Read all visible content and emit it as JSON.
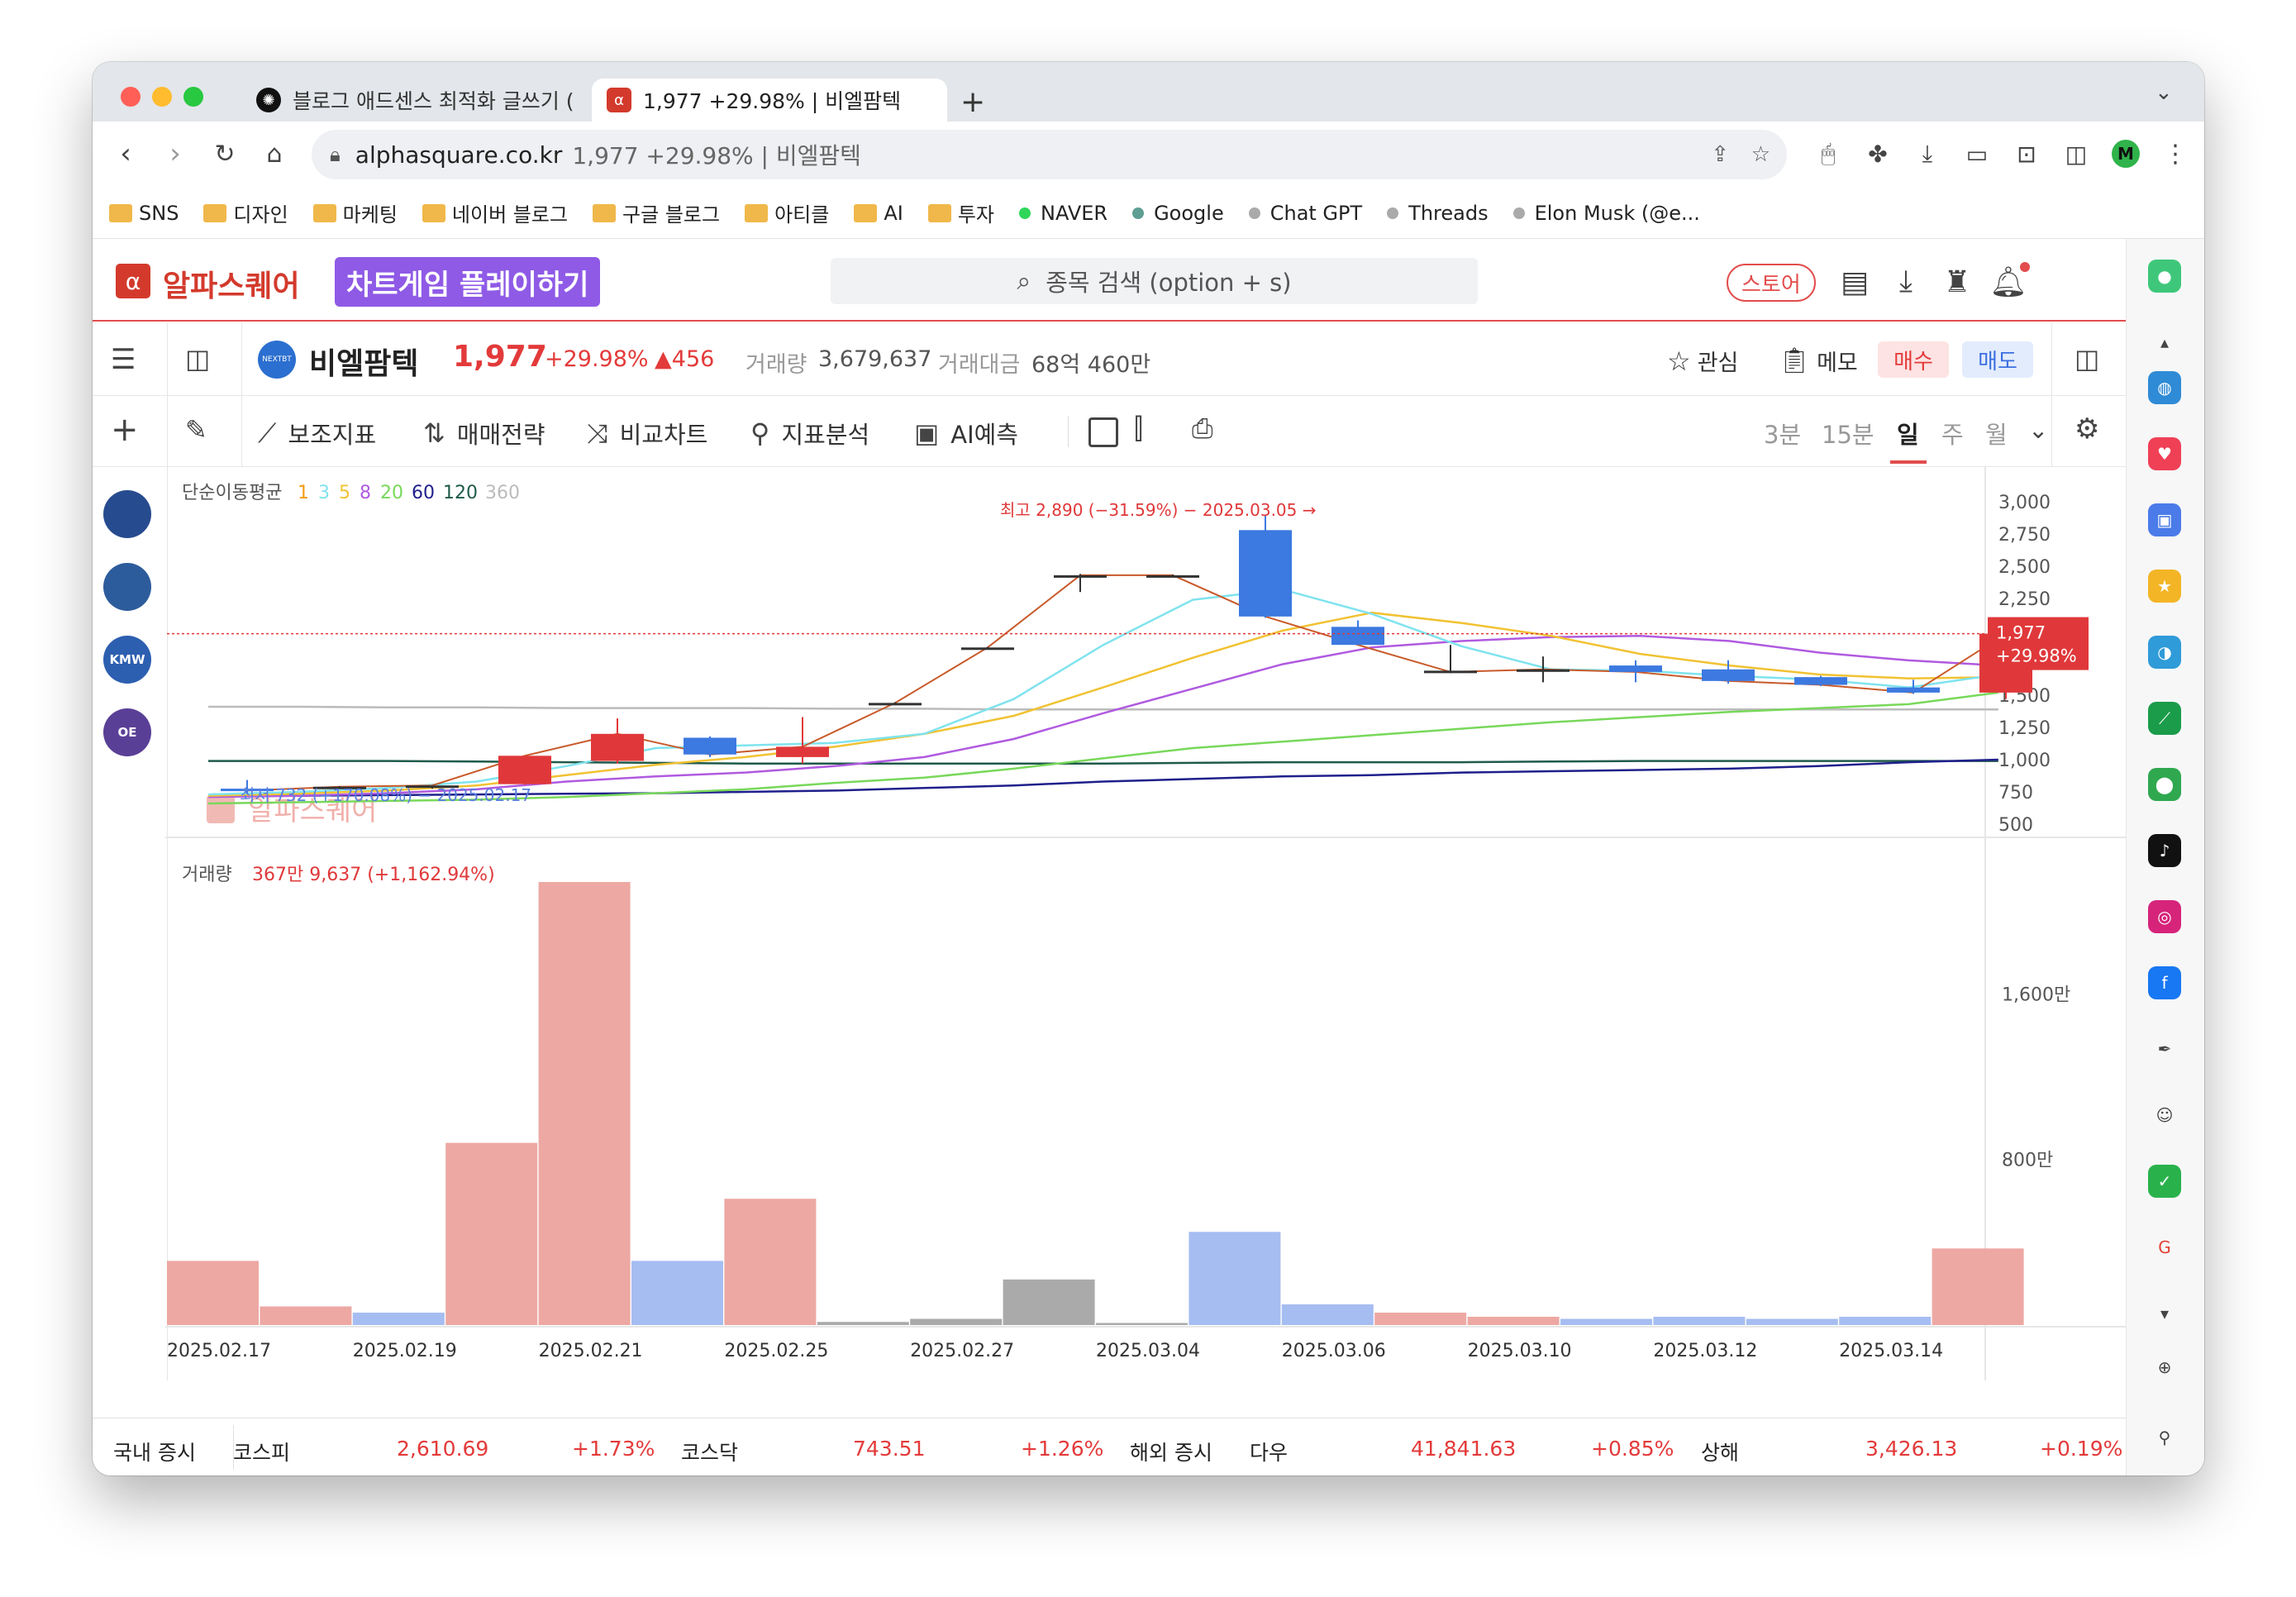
{
  "browser": {
    "tabs": [
      {
        "title": "블로그 애드센스 최적화 글쓰기 (",
        "icon": "chatgpt-icon"
      },
      {
        "title": "1,977 +29.98% | 비엘팜텍",
        "icon": "alphasquare-icon"
      }
    ],
    "new_tab": "+",
    "url_host": "alphasquare.co.kr",
    "url_title": "1,977 +29.98% | 비엘팜텍",
    "profile_letter": "M"
  },
  "bookmarks": [
    {
      "label": "SNS",
      "type": "folder"
    },
    {
      "label": "디자인",
      "type": "folder"
    },
    {
      "label": "마케팅",
      "type": "folder"
    },
    {
      "label": "네이버 블로그",
      "type": "folder"
    },
    {
      "label": "구글 블로그",
      "type": "folder"
    },
    {
      "label": "아티클",
      "type": "folder"
    },
    {
      "label": "AI",
      "type": "folder"
    },
    {
      "label": "투자",
      "type": "folder"
    },
    {
      "label": "NAVER",
      "type": "site",
      "color": "#2fd65a"
    },
    {
      "label": "Google",
      "type": "site",
      "color": "#5f9e93"
    },
    {
      "label": "Chat GPT",
      "type": "site",
      "color": "#aaaaaa"
    },
    {
      "label": "Threads",
      "type": "site",
      "color": "#aaaaaa"
    },
    {
      "label": "Elon Musk (@e...",
      "type": "site",
      "color": "#aaaaaa"
    }
  ],
  "site": {
    "logo_text": "알파스퀘어",
    "promo": "차트게임 플레이하기",
    "search_placeholder": "종목 검색 (option + s)",
    "store_label": "스토어"
  },
  "stock": {
    "logo_text": "NEXTBT",
    "name": "비엘팜텍",
    "price": "1,977",
    "change_pct": "+29.98%",
    "change_abs": "456",
    "volume_label": "거래량",
    "volume": "3,679,637",
    "amount_label": "거래대금",
    "amount": "68억 460만",
    "watch_label": "관심",
    "memo_label": "메모",
    "buy_label": "매수",
    "sell_label": "매도"
  },
  "chart_tools": {
    "tools": [
      "보조지표",
      "매매전략",
      "비교차트",
      "지표분석",
      "AI예측"
    ],
    "periods": [
      "3분",
      "15분",
      "일",
      "주",
      "월"
    ],
    "active_period": "일"
  },
  "left_rail": [
    {
      "label": "",
      "color": "#274b8f"
    },
    {
      "label": "",
      "color": "#2d5c9c"
    },
    {
      "label": "KMW",
      "color": "#2d5fb0"
    },
    {
      "label": "OE",
      "color": "#5a3f97"
    }
  ],
  "chart_data": {
    "type": "candlestick",
    "ma_label": "단순이동평균",
    "ma_periods": [
      {
        "label": "1",
        "color": "#f39c12"
      },
      {
        "label": "3",
        "color": "#7fe3ee"
      },
      {
        "label": "5",
        "color": "#f1c232"
      },
      {
        "label": "8",
        "color": "#b05ae0"
      },
      {
        "label": "20",
        "color": "#78d85a"
      },
      {
        "label": "60",
        "color": "#1f1f8c"
      },
      {
        "label": "120",
        "color": "#1f5a4a"
      },
      {
        "label": "360",
        "color": "#bbbbbb"
      }
    ],
    "colors": {
      "up": "#e0383a",
      "down": "#3c79e0",
      "volume_up": "#eda8a3",
      "volume_down": "#a6bdf1",
      "volume_flat": "#aaaaaa"
    },
    "price_ylim": [
      500,
      3000
    ],
    "price_ticks": [
      "3,000",
      "2,750",
      "2,500",
      "2,250",
      "2,000",
      "1,750",
      "1,500",
      "1,250",
      "1,000",
      "750",
      "500"
    ],
    "high_annotation": "최고 2,890 (−31.59%) − 2025.03.05",
    "low_annotation": "최저 732 (+170.08%) − 2025.02.17",
    "current_price_label": "1,977",
    "current_change_label": "+29.98%",
    "watermark": "알파스퀘어",
    "candles": [
      {
        "date": "2025.02.17",
        "open": 775,
        "high": 842,
        "low": 732,
        "close": 760
      },
      {
        "date": "2025.02.18",
        "open": 790,
        "high": 795,
        "low": 785,
        "close": 790
      },
      {
        "date": "2025.02.19",
        "open": 790,
        "high": 795,
        "low": 775,
        "close": 800
      },
      {
        "date": "2025.02.20",
        "open": 810,
        "high": 830,
        "low": 805,
        "close": 1030
      },
      {
        "date": "2025.02.21",
        "open": 990,
        "high": 1320,
        "low": 970,
        "close": 1200
      },
      {
        "date": "2025.02.24",
        "open": 1170,
        "high": 1180,
        "low": 1020,
        "close": 1040
      },
      {
        "date": "2025.02.25",
        "open": 1020,
        "high": 1330,
        "low": 970,
        "close": 1100
      },
      {
        "date": "2025.02.26",
        "open": 1440,
        "high": 1445,
        "low": 1435,
        "close": 1440
      },
      {
        "date": "2025.02.27",
        "open": 1870,
        "high": 1875,
        "low": 1865,
        "close": 1870
      },
      {
        "date": "2025.02.28",
        "open": 2430,
        "high": 2440,
        "low": 2300,
        "close": 2430
      },
      {
        "date": "2025.03.04",
        "open": 2430,
        "high": 2435,
        "low": 2425,
        "close": 2430
      },
      {
        "date": "2025.03.05",
        "open": 2780,
        "high": 2890,
        "low": 2100,
        "close": 2110
      },
      {
        "date": "2025.03.06",
        "open": 2030,
        "high": 2080,
        "low": 1890,
        "close": 1890
      },
      {
        "date": "2025.03.07",
        "open": 1690,
        "high": 1890,
        "low": 1670,
        "close": 1680
      },
      {
        "date": "2025.03.10",
        "open": 1690,
        "high": 1800,
        "low": 1600,
        "close": 1700
      },
      {
        "date": "2025.03.11",
        "open": 1730,
        "high": 1770,
        "low": 1600,
        "close": 1680
      },
      {
        "date": "2025.03.12",
        "open": 1700,
        "high": 1770,
        "low": 1590,
        "close": 1610
      },
      {
        "date": "2025.03.13",
        "open": 1640,
        "high": 1650,
        "low": 1570,
        "close": 1580
      },
      {
        "date": "2025.03.14",
        "open": 1560,
        "high": 1620,
        "low": 1510,
        "close": 1520
      },
      {
        "date": "2025.03.17",
        "open": 1520,
        "high": 1977,
        "low": 1470,
        "close": 1977
      }
    ],
    "ma_lines": {
      "3": [
        730,
        750,
        780,
        830,
        950,
        1090,
        1110,
        1130,
        1200,
        1470,
        1890,
        2240,
        2320,
        2130,
        1880,
        1700,
        1690,
        1650,
        1620,
        1560,
        1660
      ],
      "5": [
        720,
        735,
        760,
        800,
        880,
        960,
        1020,
        1100,
        1200,
        1340,
        1560,
        1790,
        2000,
        2140,
        2060,
        1960,
        1820,
        1730,
        1660,
        1630,
        1640
      ],
      "8": [
        710,
        720,
        740,
        770,
        830,
        870,
        900,
        950,
        1020,
        1160,
        1360,
        1550,
        1740,
        1870,
        1920,
        1950,
        1960,
        1920,
        1830,
        1770,
        1730
      ],
      "20": [
        660,
        670,
        680,
        690,
        710,
        740,
        770,
        820,
        860,
        930,
        1010,
        1090,
        1140,
        1190,
        1240,
        1290,
        1330,
        1370,
        1400,
        1430,
        1520
      ],
      "60": [
        720,
        720,
        725,
        730,
        735,
        740,
        750,
        760,
        780,
        800,
        830,
        850,
        870,
        880,
        900,
        910,
        920,
        930,
        950,
        980,
        1000
      ],
      "120": [
        990,
        990,
        990,
        985,
        980,
        975,
        970,
        970,
        970,
        970,
        970,
        975,
        980,
        980,
        980,
        985,
        990,
        990,
        990,
        990,
        990
      ],
      "360": [
        1410,
        1410,
        1405,
        1405,
        1400,
        1400,
        1400,
        1395,
        1395,
        1390,
        1390,
        1390,
        1390,
        1390,
        1390,
        1390,
        1390,
        1390,
        1390,
        1390,
        1390
      ]
    },
    "volume_label": "거래량",
    "volume_value": "367만 9,637 (+1,162.94%)",
    "volume_ticks": [
      "1,600만",
      "800만"
    ],
    "volume_unit_values": [
      1600,
      800
    ],
    "volumes": [
      {
        "value": 310,
        "dir": "up"
      },
      {
        "value": 90,
        "dir": "up"
      },
      {
        "value": 60,
        "dir": "down"
      },
      {
        "value": 880,
        "dir": "up"
      },
      {
        "value": 2140,
        "dir": "up"
      },
      {
        "value": 310,
        "dir": "down"
      },
      {
        "value": 610,
        "dir": "up"
      },
      {
        "value": 15,
        "dir": "flat"
      },
      {
        "value": 30,
        "dir": "flat"
      },
      {
        "value": 220,
        "dir": "flat"
      },
      {
        "value": 10,
        "dir": "flat"
      },
      {
        "value": 450,
        "dir": "down"
      },
      {
        "value": 100,
        "dir": "down"
      },
      {
        "value": 60,
        "dir": "up"
      },
      {
        "value": 40,
        "dir": "up"
      },
      {
        "value": 30,
        "dir": "down"
      },
      {
        "value": 40,
        "dir": "down"
      },
      {
        "value": 30,
        "dir": "down"
      },
      {
        "value": 40,
        "dir": "down"
      },
      {
        "value": 370,
        "dir": "up"
      }
    ],
    "volume_ylim": [
      0,
      2200
    ],
    "x_labels": [
      "2025.02.17",
      "2025.02.19",
      "2025.02.21",
      "2025.02.25",
      "2025.02.27",
      "2025.03.04",
      "2025.03.06",
      "2025.03.10",
      "2025.03.12",
      "2025.03.14"
    ],
    "x_label_index": [
      0,
      2,
      4,
      6,
      8,
      10,
      12,
      14,
      16,
      18
    ]
  },
  "ticker": {
    "domestic_label": "국내 증시",
    "kospi_label": "코스피",
    "kospi_value": "2,610.69",
    "kospi_change": "+1.73%",
    "kosdaq_label": "코스닥",
    "kosdaq_value": "743.51",
    "kosdaq_change": "+1.26%",
    "overseas_label": "해외 증시",
    "dow_label": "다우",
    "dow_value": "41,841.63",
    "dow_change": "+0.85%",
    "shanghai_label": "상해",
    "shanghai_value": "3,426.13",
    "shanghai_change": "+0.19%"
  }
}
